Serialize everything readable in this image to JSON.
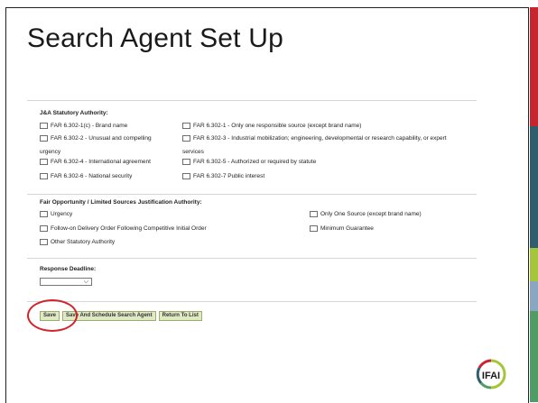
{
  "title": "Search Agent Set Up",
  "colors": {
    "highlight": "#d2232a",
    "button_bg": "#dfe9c4",
    "sidebar_red": "#c7262f",
    "sidebar_teal": "#2f5e6e",
    "sidebar_lime": "#a5c53a",
    "sidebar_blue": "#8aa7c2",
    "sidebar_green": "#4f9d64"
  },
  "ja_section": {
    "heading": "J&A Statutory Authority:",
    "left": [
      "FAR 6.302-1(c) - Brand name",
      "FAR 6.302-2 - Unusual and compelling",
      "FAR 6.302-4 - International agreement",
      "FAR 6.302-6 - National security"
    ],
    "left_wrap": "urgency",
    "right": [
      "FAR 6.302-1 - Only one responsible source (except brand name)",
      "FAR 6.302-3 - Industrial mobilization; engineering, developmental or research capability, or expert",
      "FAR 6.302-5 - Authorized or required by statute",
      "FAR 6.302-7 Public interest"
    ],
    "right_wrap": "services"
  },
  "fair_section": {
    "heading": "Fair Opportunity / Limited Sources Justification Authority:",
    "left": [
      "Urgency",
      "Follow-on Delivery Order Following Competitive Initial Order",
      "Other Statutory Authority"
    ],
    "right": [
      "Only One Source (except brand name)",
      "Minimum Guarantee"
    ]
  },
  "response": {
    "label": "Response Deadline:",
    "selected": ""
  },
  "buttons": {
    "save": "Save",
    "save_schedule": "Save And Schedule Search Agent",
    "return": "Return To List"
  },
  "logo_text": "IFAI"
}
